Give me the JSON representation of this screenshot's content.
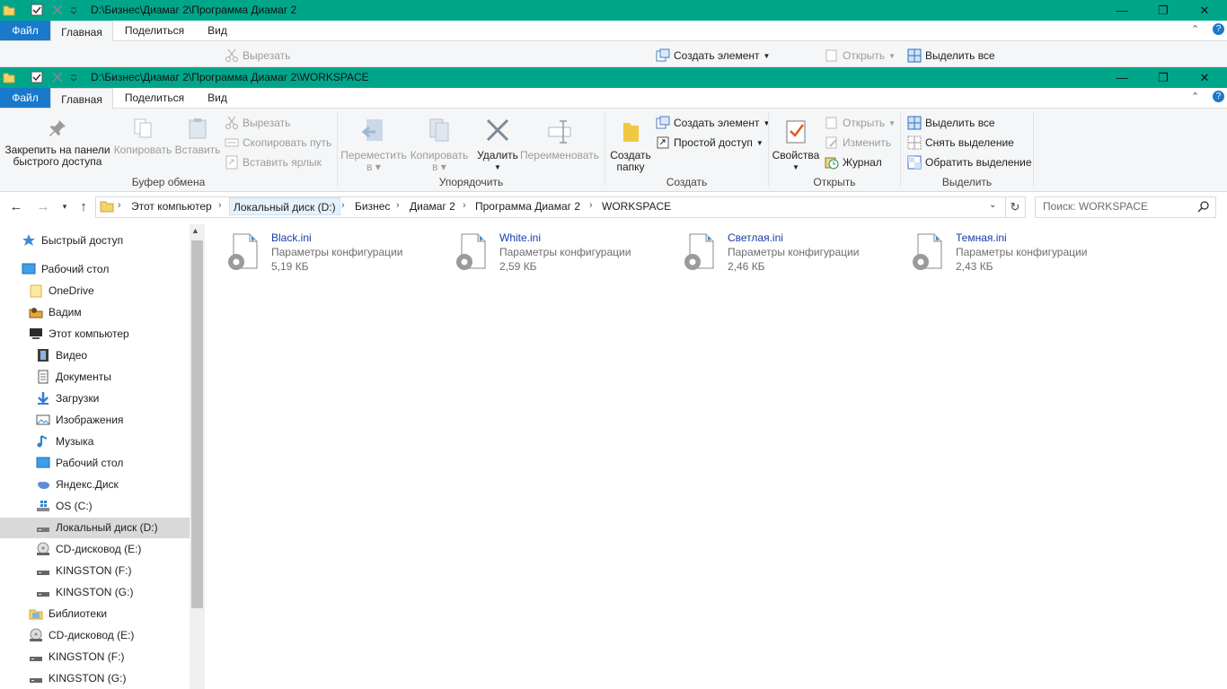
{
  "back_window": {
    "title": "D:\\Бизнес\\Диамаг 2\\Программа Диамаг 2",
    "tabs": {
      "file": "Файл",
      "home": "Главная",
      "share": "Поделиться",
      "view": "Вид"
    },
    "visible_commands": {
      "cut": "Вырезать",
      "new_item": "Создать элемент",
      "open": "Открыть",
      "select_all": "Выделить все"
    }
  },
  "window": {
    "title": "D:\\Бизнес\\Диамаг 2\\Программа Диамаг 2\\WORKSPACE",
    "controls": {
      "minimize": "—",
      "maximize": "❐",
      "close": "✕"
    }
  },
  "ribbon": {
    "tabs": {
      "file": "Файл",
      "home": "Главная",
      "share": "Поделиться",
      "view": "Вид"
    },
    "groups": {
      "clipboard": {
        "label": "Буфер обмена",
        "pin_line1": "Закрепить на панели",
        "pin_line2": "быстрого доступа",
        "copy": "Копировать",
        "paste": "Вставить",
        "cut": "Вырезать",
        "copy_path": "Скопировать путь",
        "paste_shortcut": "Вставить ярлык"
      },
      "organize": {
        "label": "Упорядочить",
        "move_line1": "Переместить",
        "move_line2": "в",
        "copyto_line1": "Копировать",
        "copyto_line2": "в",
        "delete": "Удалить",
        "rename": "Переименовать"
      },
      "new": {
        "label": "Создать",
        "newfolder_line1": "Создать",
        "newfolder_line2": "папку",
        "new_item": "Создать элемент",
        "easy_access": "Простой доступ"
      },
      "open": {
        "label": "Открыть",
        "properties": "Свойства",
        "open": "Открыть",
        "edit": "Изменить",
        "history": "Журнал"
      },
      "select": {
        "label": "Выделить",
        "select_all": "Выделить все",
        "select_none": "Снять выделение",
        "invert": "Обратить выделение"
      }
    }
  },
  "address": {
    "crumbs": [
      "Этот компьютер",
      "Локальный диск (D:)",
      "Бизнес",
      "Диамаг 2",
      "Программа Диамаг 2",
      "WORKSPACE"
    ],
    "search_placeholder": "Поиск: WORKSPACE"
  },
  "nav": [
    "Быстрый доступ",
    "Рабочий стол",
    "OneDrive",
    "Вадим",
    "Этот компьютер",
    "Видео",
    "Документы",
    "Загрузки",
    "Изображения",
    "Музыка",
    "Рабочий стол",
    "Яндекс.Диск",
    "OS (C:)",
    "Локальный диск (D:)",
    "CD-дисковод (E:)",
    "KINGSTON (F:)",
    "KINGSTON (G:)",
    "Библиотеки",
    "CD-дисковод (E:)",
    "KINGSTON (F:)",
    "KINGSTON (G:)"
  ],
  "files": [
    {
      "name": "Black.ini",
      "type": "Параметры конфигурации",
      "size": "5,19 КБ"
    },
    {
      "name": "White.ini",
      "type": "Параметры конфигурации",
      "size": "2,59 КБ"
    },
    {
      "name": "Светлая.ini",
      "type": "Параметры конфигурации",
      "size": "2,46 КБ"
    },
    {
      "name": "Темная.ini",
      "type": "Параметры конфигурации",
      "size": "2,43 КБ"
    }
  ],
  "colors": {
    "accent": "#00a68a",
    "file_tab": "#1979ca",
    "link": "#1a3ca8"
  }
}
